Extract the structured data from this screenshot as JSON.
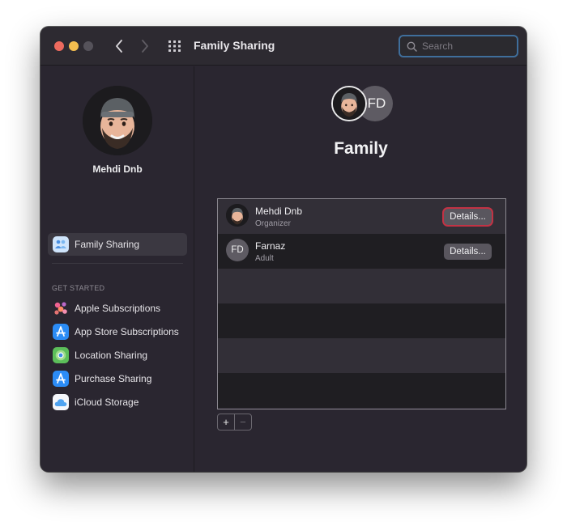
{
  "window": {
    "title": "Family Sharing",
    "search_placeholder": "Search"
  },
  "toolbar": {
    "back_icon": "chevron-left-icon",
    "forward_icon": "chevron-right-icon",
    "grid_icon": "show-all-grid-icon"
  },
  "sidebar": {
    "profile_name": "Mehdi Dnb",
    "selected_item": {
      "label": "Family Sharing",
      "icon": "family-sharing-icon"
    },
    "section_header": "GET STARTED",
    "items": [
      {
        "label": "Apple Subscriptions",
        "icon": "apple-subscriptions-icon"
      },
      {
        "label": "App Store Subscriptions",
        "icon": "app-store-icon"
      },
      {
        "label": "Location Sharing",
        "icon": "location-sharing-icon"
      },
      {
        "label": "Purchase Sharing",
        "icon": "purchase-sharing-icon"
      },
      {
        "label": "iCloud Storage",
        "icon": "icloud-icon"
      }
    ]
  },
  "main": {
    "hero_initials": "FD",
    "title": "Family",
    "members": [
      {
        "name": "Mehdi Dnb",
        "role": "Organizer",
        "button": "Details..."
      },
      {
        "name": "Farnaz",
        "role": "Adult",
        "initials": "FD",
        "button": "Details..."
      }
    ],
    "add_label": "+",
    "remove_label": "−",
    "help_label": "?"
  },
  "colors": {
    "window_bg": "#2a2630",
    "accent_focus": "#c23244",
    "search_ring": "#3f6e9b"
  }
}
